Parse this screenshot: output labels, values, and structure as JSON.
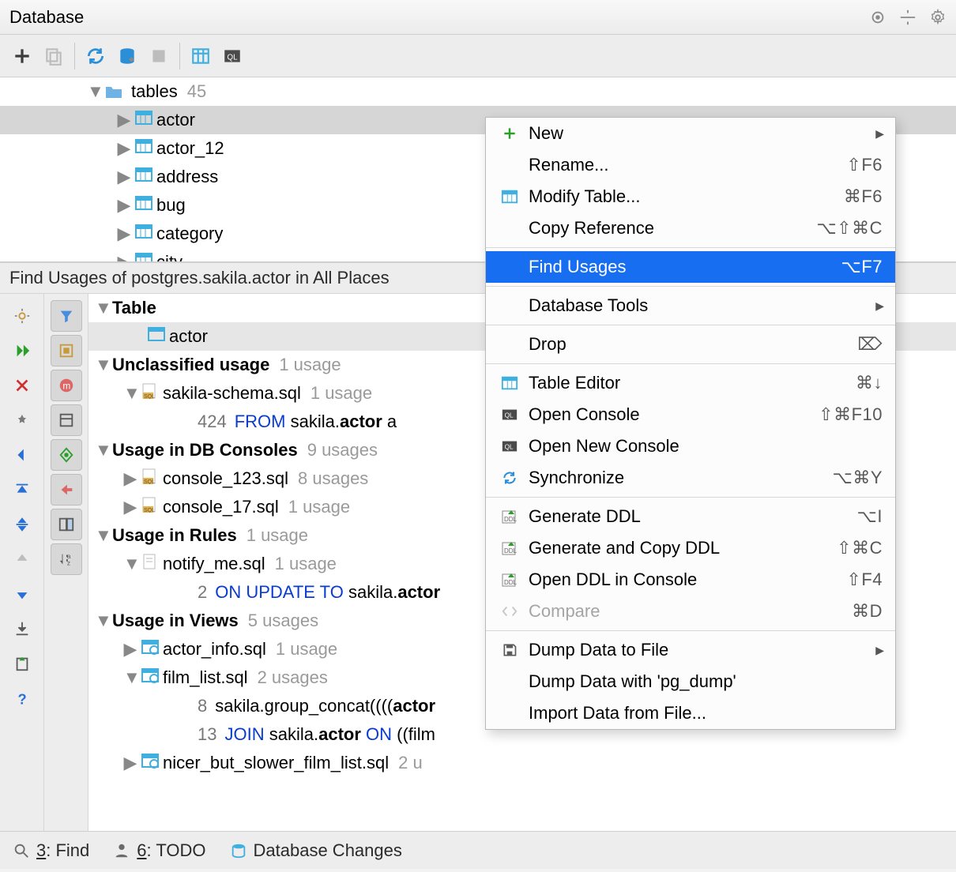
{
  "title": "Database",
  "tree": {
    "folder_label": "tables",
    "folder_count": "45",
    "tables": [
      "actor",
      "actor_12",
      "address",
      "bug",
      "category",
      "city"
    ]
  },
  "findbar": "Find Usages of postgres.sakila.actor in All Places",
  "usages": {
    "table_header": "Table",
    "table_name": "actor",
    "groups": [
      {
        "title": "Unclassified usage",
        "count": "1 usage",
        "files": [
          {
            "name": "sakila-schema.sql",
            "count": "1 usage",
            "lines": [
              {
                "num": "424",
                "pre": "FROM",
                "mid": " sakila.",
                "bold": "actor",
                "post": " a"
              }
            ]
          }
        ]
      },
      {
        "title": "Usage in DB Consoles",
        "count": "9 usages",
        "files": [
          {
            "name": "console_123.sql",
            "count": "8 usages",
            "collapsed": true
          },
          {
            "name": "console_17.sql",
            "count": "1 usage",
            "collapsed": true
          }
        ]
      },
      {
        "title": "Usage in Rules",
        "count": "1 usage",
        "files": [
          {
            "name": "notify_me.sql",
            "count": "1 usage",
            "lines": [
              {
                "num": "2",
                "pre": "ON UPDATE TO",
                "mid": " sakila.",
                "bold": "actor",
                "post": ""
              }
            ]
          }
        ]
      },
      {
        "title": "Usage in Views",
        "count": "5 usages",
        "files": [
          {
            "name": "actor_info.sql",
            "count": "1 usage",
            "collapsed": true,
            "view": true
          },
          {
            "name": "film_list.sql",
            "count": "2 usages",
            "view": true,
            "lines": [
              {
                "num": "8",
                "plain": "sakila.group_concat((((",
                "bold": "actor",
                "post": ""
              },
              {
                "num": "13",
                "pre": "JOIN",
                "mid": " sakila.",
                "bold": "actor",
                "kw2": " ON",
                "post": " ((film"
              }
            ]
          },
          {
            "name": "nicer_but_slower_film_list.sql",
            "count": "2 u",
            "collapsed": true,
            "view": true
          }
        ]
      }
    ]
  },
  "statusbar": {
    "find": "3: Find",
    "todo": "6: TODO",
    "dbchanges": "Database Changes"
  },
  "context_menu": [
    {
      "label": "New",
      "sub": true,
      "icon": "plus"
    },
    {
      "label": "Rename...",
      "shortcut": "⇧F6"
    },
    {
      "label": "Modify Table...",
      "shortcut": "⌘F6",
      "icon": "table"
    },
    {
      "label": "Copy Reference",
      "shortcut": "⌥⇧⌘C"
    },
    {
      "sep": true
    },
    {
      "label": "Find Usages",
      "shortcut": "⌥F7",
      "selected": true
    },
    {
      "sep": true
    },
    {
      "label": "Database Tools",
      "sub": true
    },
    {
      "sep": true
    },
    {
      "label": "Drop",
      "shortcut": "⌦"
    },
    {
      "sep": true
    },
    {
      "label": "Table Editor",
      "shortcut": "⌘↓",
      "icon": "table"
    },
    {
      "label": "Open Console",
      "shortcut": "⇧⌘F10",
      "icon": "ql"
    },
    {
      "label": "Open New Console",
      "icon": "ql"
    },
    {
      "label": "Synchronize",
      "shortcut": "⌥⌘Y",
      "icon": "refresh"
    },
    {
      "sep": true
    },
    {
      "label": "Generate DDL",
      "shortcut": "⌥I",
      "icon": "ddl"
    },
    {
      "label": "Generate and Copy DDL",
      "shortcut": "⇧⌘C",
      "icon": "ddl"
    },
    {
      "label": "Open DDL in Console",
      "shortcut": "⇧F4",
      "icon": "ddl"
    },
    {
      "label": "Compare",
      "shortcut": "⌘D",
      "icon": "compare",
      "dim": true
    },
    {
      "sep": true
    },
    {
      "label": "Dump Data to File",
      "sub": true,
      "icon": "save"
    },
    {
      "label": "Dump Data with 'pg_dump'"
    },
    {
      "label": "Import Data from File..."
    }
  ]
}
